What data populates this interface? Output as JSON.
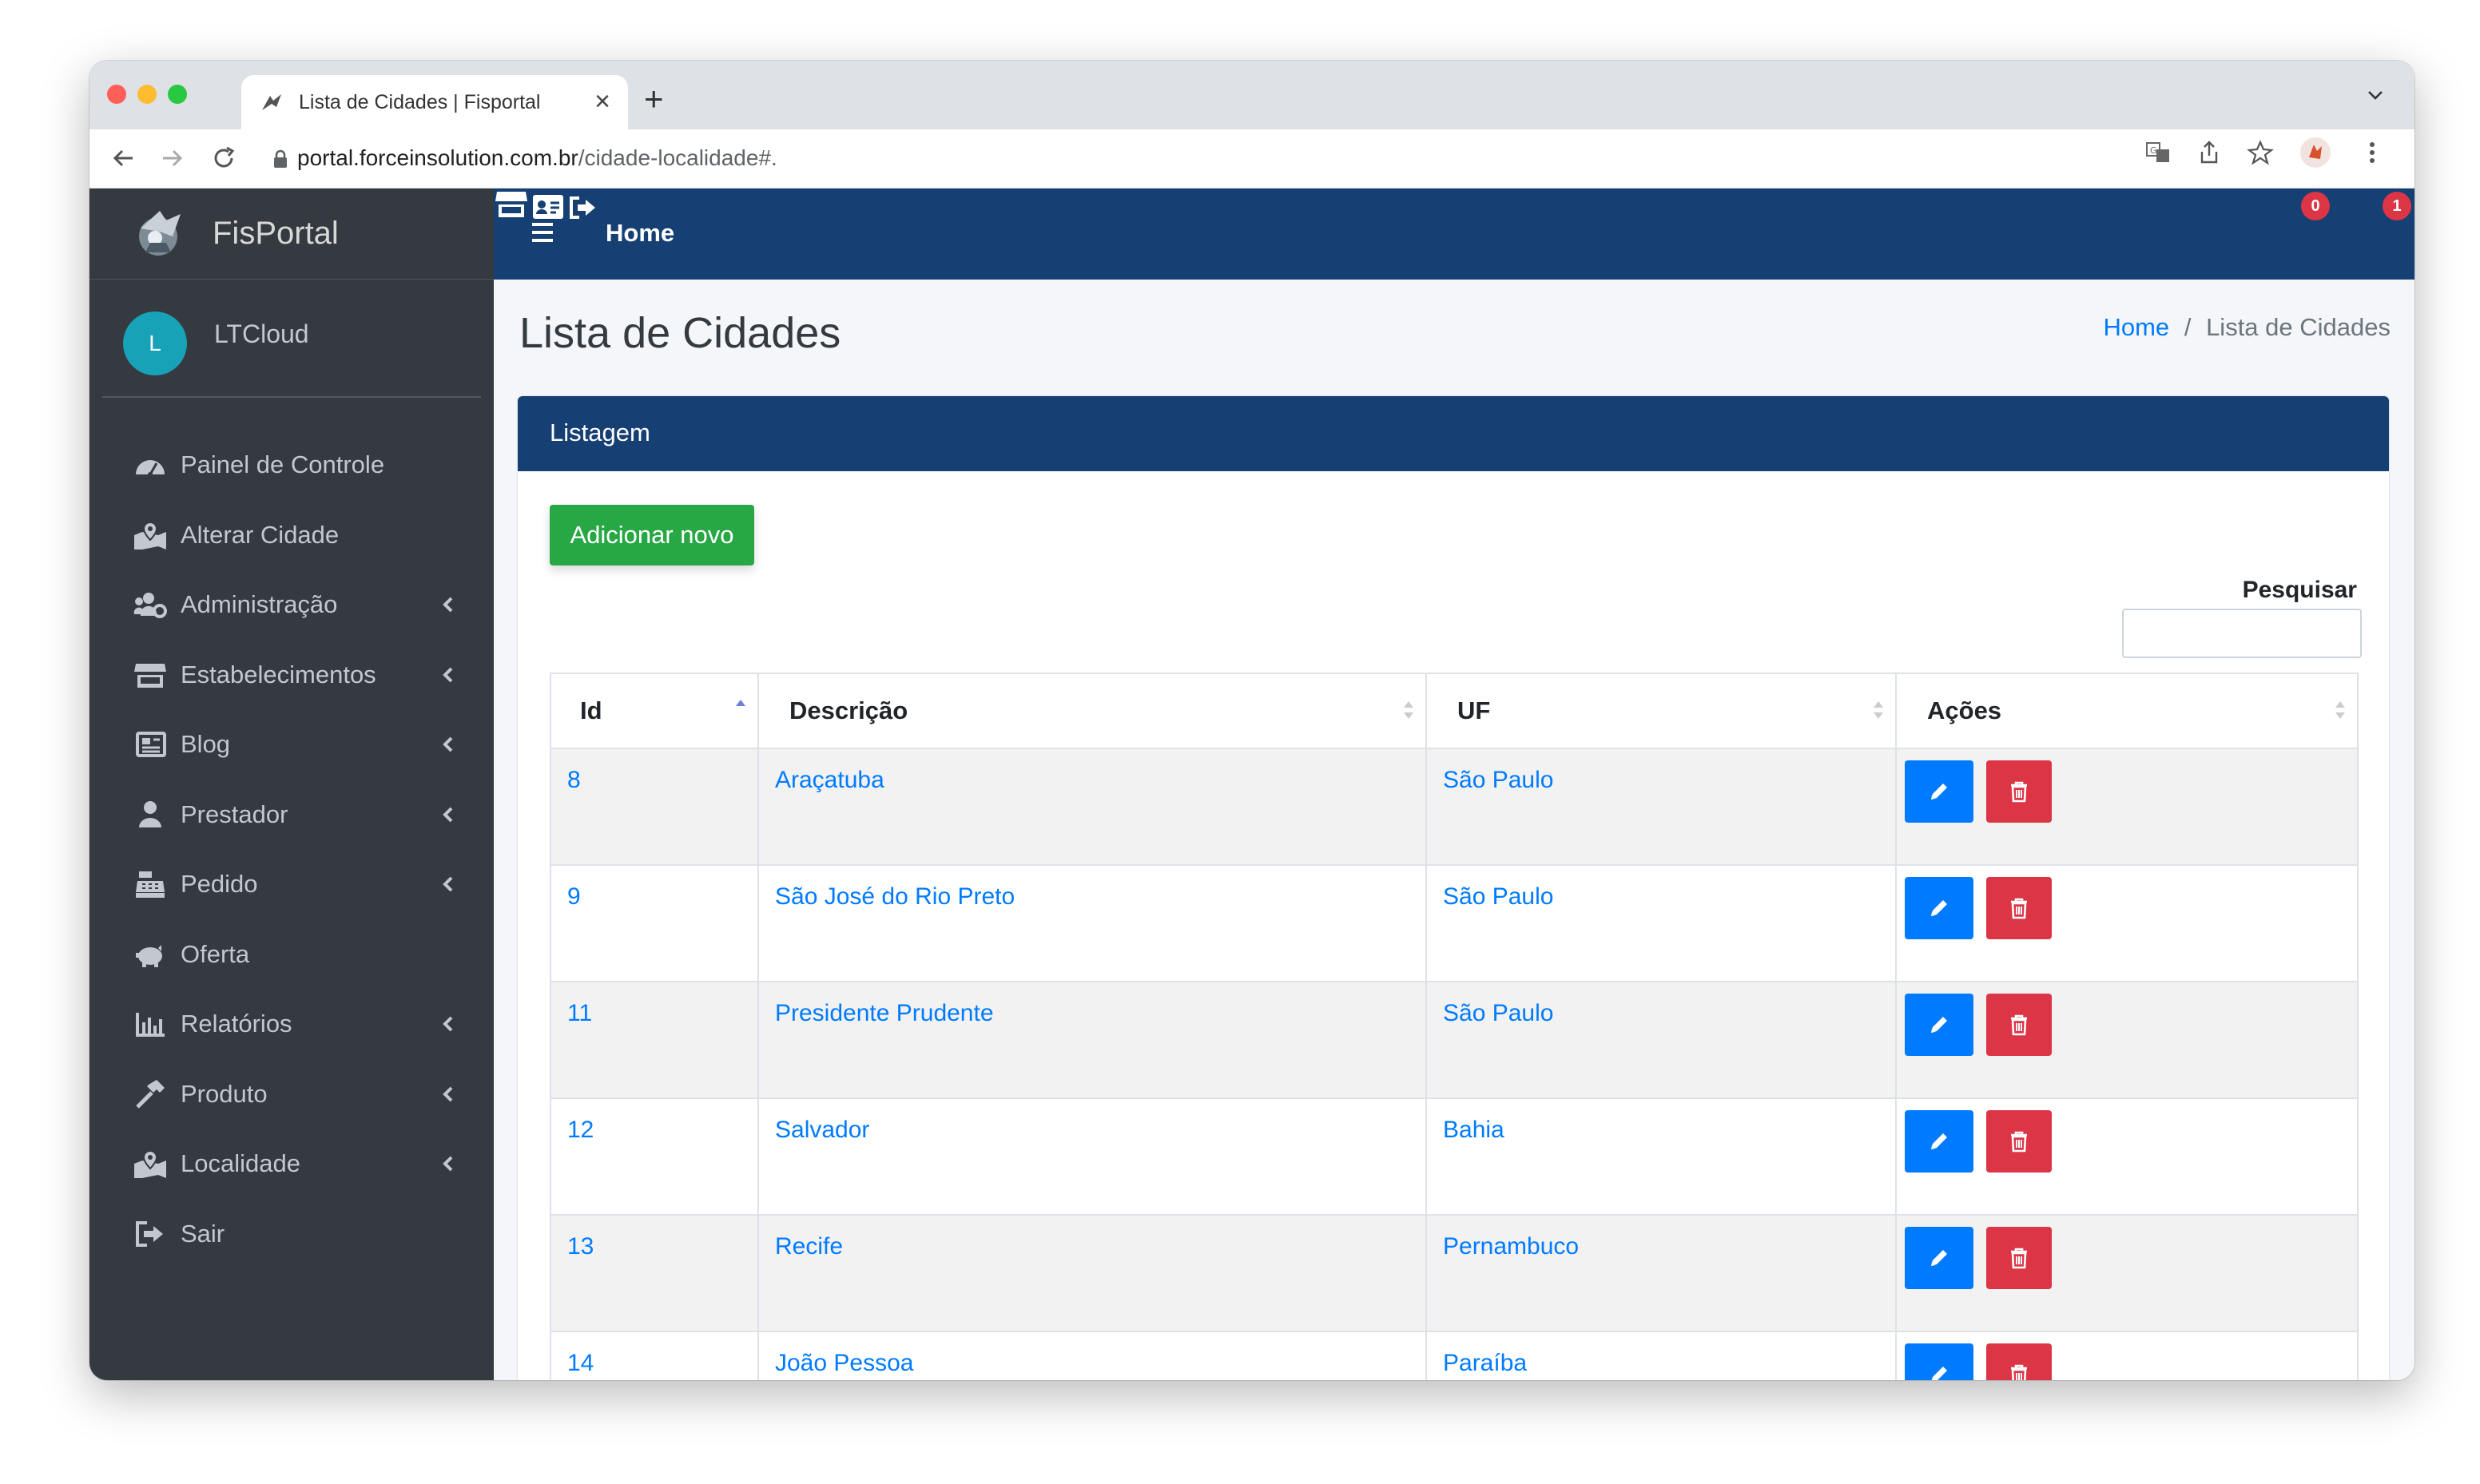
{
  "browser": {
    "tab_title": "Lista de Cidades | Fisportal",
    "url_host": "portal.forceinsolution.com.br",
    "url_path": "/cidade-localidade#.",
    "colors": {
      "close": "#ff5f57",
      "minimize": "#febc2e",
      "zoom": "#28c840"
    }
  },
  "sidebar": {
    "brand": "FisPortal",
    "user_initial": "L",
    "user_name": "LTCloud",
    "items": [
      {
        "label": "Painel de Controle",
        "icon": "dashboard-icon",
        "chevron": false
      },
      {
        "label": "Alterar Cidade",
        "icon": "map-marked-icon",
        "chevron": false
      },
      {
        "label": "Administração",
        "icon": "users-cog-icon",
        "chevron": true
      },
      {
        "label": "Estabelecimentos",
        "icon": "store-icon",
        "chevron": true
      },
      {
        "label": "Blog",
        "icon": "newspaper-icon",
        "chevron": true
      },
      {
        "label": "Prestador",
        "icon": "user-icon",
        "chevron": true
      },
      {
        "label": "Pedido",
        "icon": "cash-register-icon",
        "chevron": true
      },
      {
        "label": "Oferta",
        "icon": "piggy-bank-icon",
        "chevron": false
      },
      {
        "label": "Relatórios",
        "icon": "chart-bar-icon",
        "chevron": true
      },
      {
        "label": "Produto",
        "icon": "hammer-icon",
        "chevron": true
      },
      {
        "label": "Localidade",
        "icon": "map-marked-icon",
        "chevron": true
      },
      {
        "label": "Sair",
        "icon": "sign-out-icon",
        "chevron": false
      }
    ]
  },
  "topnav": {
    "home": "Home",
    "store_badge": "0",
    "card_badge": "1"
  },
  "page": {
    "title": "Lista de Cidades",
    "breadcrumb_home": "Home",
    "breadcrumb_sep": "/",
    "breadcrumb_current": "Lista de Cidades"
  },
  "card": {
    "title": "Listagem",
    "add_button": "Adicionar novo",
    "search_label": "Pesquisar",
    "search_value": ""
  },
  "table": {
    "columns": [
      "Id",
      "Descrição",
      "UF",
      "Ações"
    ],
    "rows": [
      {
        "id": "8",
        "descricao": "Araçatuba",
        "uf": "São Paulo"
      },
      {
        "id": "9",
        "descricao": "São José do Rio Preto",
        "uf": "São Paulo"
      },
      {
        "id": "11",
        "descricao": "Presidente Prudente",
        "uf": "São Paulo"
      },
      {
        "id": "12",
        "descricao": "Salvador",
        "uf": "Bahia"
      },
      {
        "id": "13",
        "descricao": "Recife",
        "uf": "Pernambuco"
      },
      {
        "id": "14",
        "descricao": "João Pessoa",
        "uf": "Paraíba"
      }
    ]
  }
}
